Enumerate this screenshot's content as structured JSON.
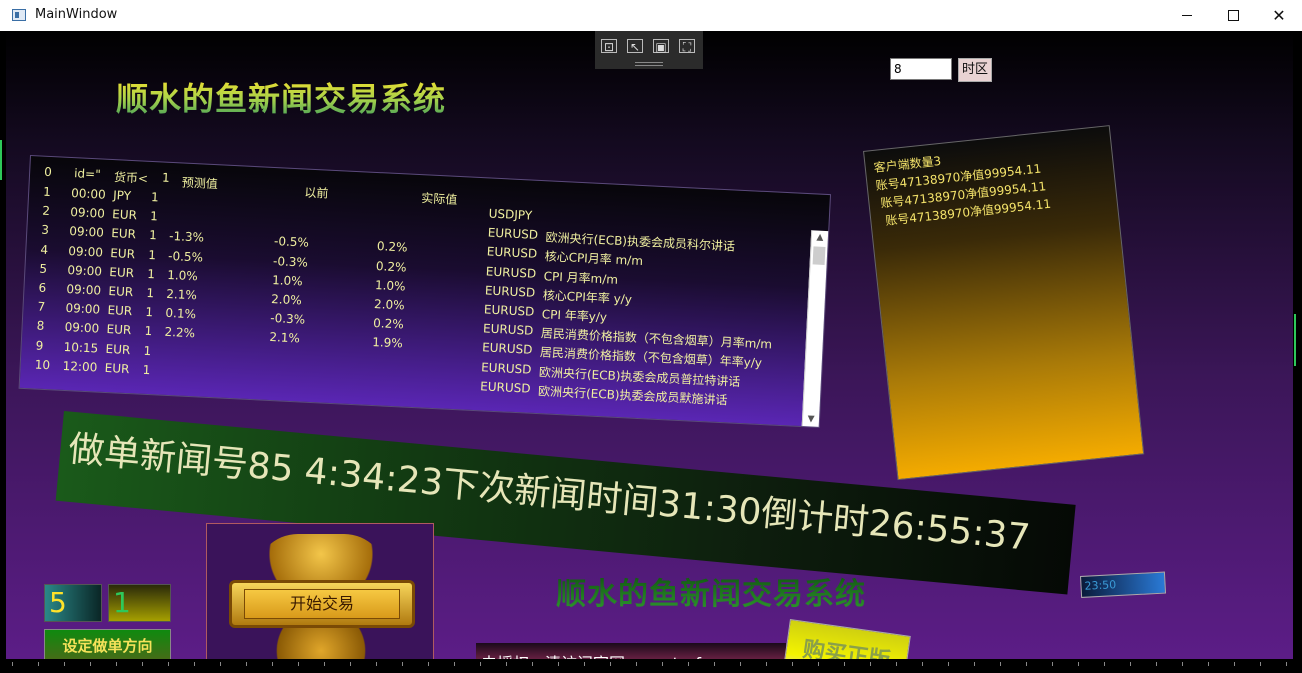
{
  "window": {
    "title": "MainWindow",
    "minimize": "—",
    "maximize": "☐",
    "close": "✕"
  },
  "app": {
    "title": "顺水的鱼新闻交易系统",
    "subtitle": "顺水的鱼新闻交易系统",
    "timezone_value": "8",
    "timezone_button": "时区"
  },
  "news_table": {
    "headers": [
      "0",
      "id=\"",
      "货币<",
      "1",
      "预测值",
      "以前",
      "实际值"
    ],
    "rows": [
      {
        "idx": "1",
        "time": "00:00",
        "cur": "JPY",
        "n": "1",
        "forecast": "",
        "prev": "",
        "actual": "",
        "pair": "USDJPY",
        "event": ""
      },
      {
        "idx": "2",
        "time": "09:00",
        "cur": "EUR",
        "n": "1",
        "forecast": "",
        "prev": "",
        "actual": "",
        "pair": "EURUSD",
        "event": "欧洲央行(ECB)执委会成员科尔讲话"
      },
      {
        "idx": "3",
        "time": "09:00",
        "cur": "EUR",
        "n": "1",
        "forecast": "-1.3%",
        "prev": "-0.5%",
        "actual": "0.2%",
        "pair": "EURUSD",
        "event": "核心CPI月率 m/m"
      },
      {
        "idx": "4",
        "time": "09:00",
        "cur": "EUR",
        "n": "1",
        "forecast": "-0.5%",
        "prev": "-0.3%",
        "actual": "0.2%",
        "pair": "EURUSD",
        "event": "CPI 月率m/m"
      },
      {
        "idx": "5",
        "time": "09:00",
        "cur": "EUR",
        "n": "1",
        "forecast": "1.0%",
        "prev": "1.0%",
        "actual": "1.0%",
        "pair": "EURUSD",
        "event": "核心CPI年率 y/y"
      },
      {
        "idx": "6",
        "time": "09:00",
        "cur": "EUR",
        "n": "1",
        "forecast": "2.1%",
        "prev": "2.0%",
        "actual": "2.0%",
        "pair": "EURUSD",
        "event": "CPI 年率y/y"
      },
      {
        "idx": "7",
        "time": "09:00",
        "cur": "EUR",
        "n": "1",
        "forecast": "0.1%",
        "prev": "-0.3%",
        "actual": "0.2%",
        "pair": "EURUSD",
        "event": "居民消费价格指数（不包含烟草）月率m/m"
      },
      {
        "idx": "8",
        "time": "09:00",
        "cur": "EUR",
        "n": "1",
        "forecast": "2.2%",
        "prev": "2.1%",
        "actual": "1.9%",
        "pair": "EURUSD",
        "event": "居民消费价格指数（不包含烟草）年率y/y"
      },
      {
        "idx": "9",
        "time": "10:15",
        "cur": "EUR",
        "n": "1",
        "forecast": "",
        "prev": "",
        "actual": "",
        "pair": "EURUSD",
        "event": "欧洲央行(ECB)执委会成员普拉特讲话"
      },
      {
        "idx": "10",
        "time": "12:00",
        "cur": "EUR",
        "n": "1",
        "forecast": "",
        "prev": "",
        "actual": "",
        "pair": "EURUSD",
        "event": "欧洲央行(ECB)执委会成员默施讲话"
      }
    ]
  },
  "client_panel": {
    "lines": [
      "客户端数量3",
      "账号47138970净值99954.11",
      "账号47138970净值99954.11",
      "账号47138970净值99954.11"
    ]
  },
  "banner": {
    "text": "做单新闻号85   4:34:23下次新闻时间31:30倒计时26:55:37"
  },
  "direction": {
    "value_a": "5",
    "value_b": "1",
    "button": "设定做单方向"
  },
  "logo": {
    "plaque_text": "开始交易"
  },
  "clock": {
    "text": "23:50"
  },
  "license": {
    "text": "未授权，清访问官网ea.waterforex.com",
    "buy_button": "购买正版"
  },
  "devtools": {
    "icons": [
      "select-tool-icon",
      "pointer-icon",
      "frame-icon",
      "screenshot-icon"
    ]
  }
}
